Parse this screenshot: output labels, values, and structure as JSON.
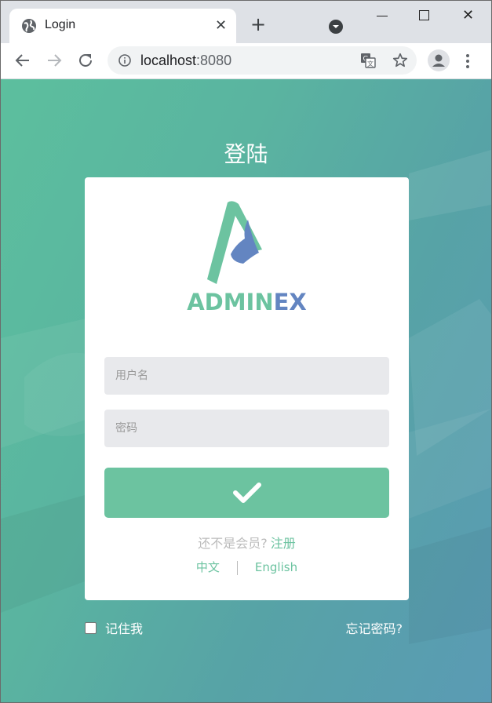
{
  "browser": {
    "tab_title": "Login",
    "url_host": "localhost",
    "url_port": ":8080"
  },
  "page": {
    "heading": "登陆",
    "logo": {
      "part1": "ADMIN",
      "part2": "EX"
    },
    "username_placeholder": "用户名",
    "password_placeholder": "密码",
    "register_question": "还不是会员?",
    "register_link": "注册",
    "lang_zh": "中文",
    "lang_en": "English",
    "remember_me": "记住我",
    "forgot_password": "忘记密码?"
  },
  "colors": {
    "accent": "#6cc3a0",
    "logo_blue": "#6385c1"
  },
  "icons": [
    "globe-icon",
    "close-icon",
    "plus-icon",
    "tab-search-icon",
    "back-icon",
    "forward-icon",
    "reload-icon",
    "info-icon",
    "translate-icon",
    "star-icon",
    "profile-icon",
    "menu-icon",
    "check-icon"
  ]
}
